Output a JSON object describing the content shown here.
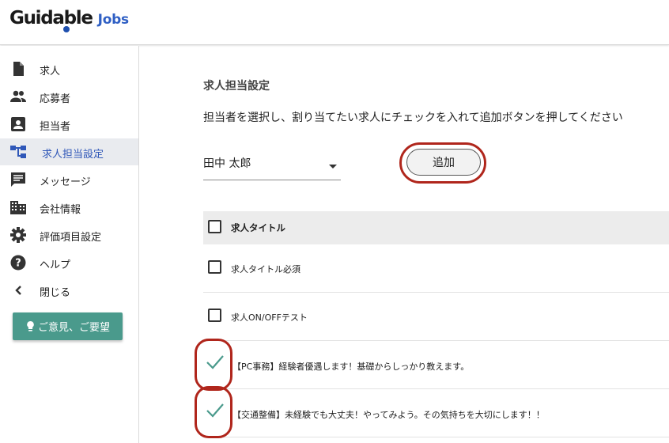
{
  "header": {
    "logo_main": "Guidable",
    "logo_sub": "Jobs",
    "brand_color": "#2f5fc4"
  },
  "sidebar": {
    "items": [
      {
        "label": "求人",
        "icon": "document-icon",
        "active": false
      },
      {
        "label": "応募者",
        "icon": "people-icon",
        "active": false
      },
      {
        "label": "担当者",
        "icon": "contact-card-icon",
        "active": false
      },
      {
        "label": "求人担当設定",
        "icon": "hierarchy-icon",
        "active": true
      },
      {
        "label": "メッセージ",
        "icon": "message-icon",
        "active": false
      },
      {
        "label": "会社情報",
        "icon": "building-icon",
        "active": false
      },
      {
        "label": "評価項目設定",
        "icon": "gear-icon",
        "active": false
      },
      {
        "label": "ヘルプ",
        "icon": "help-icon",
        "active": false
      },
      {
        "label": "閉じる",
        "icon": "chevron-left-icon",
        "active": false
      }
    ],
    "feedback_label": "ご意見、ご要望",
    "feedback_color": "#4a9a8c",
    "active_color": "#2f57b8"
  },
  "main": {
    "title": "求人担当設定",
    "description": "担当者を選択し、割り当てたい求人にチェックを入れて追加ボタンを押してください",
    "assignee_select": {
      "value": "田中 太郎"
    },
    "add_button_label": "追加",
    "highlight_color": "#b0261c"
  },
  "table": {
    "header_label": "求人タイトル",
    "rows": [
      {
        "title": "求人タイトル必須",
        "checked": false
      },
      {
        "title": "求人ON/OFFテスト",
        "checked": false
      },
      {
        "title": "【PC事務】経験者優遇します！基礎からしっかり教えます。",
        "checked": true
      },
      {
        "title": "【交通整備】未経験でも大丈夫！やってみよう。その気持ちを大切にします！！",
        "checked": true
      }
    ]
  }
}
